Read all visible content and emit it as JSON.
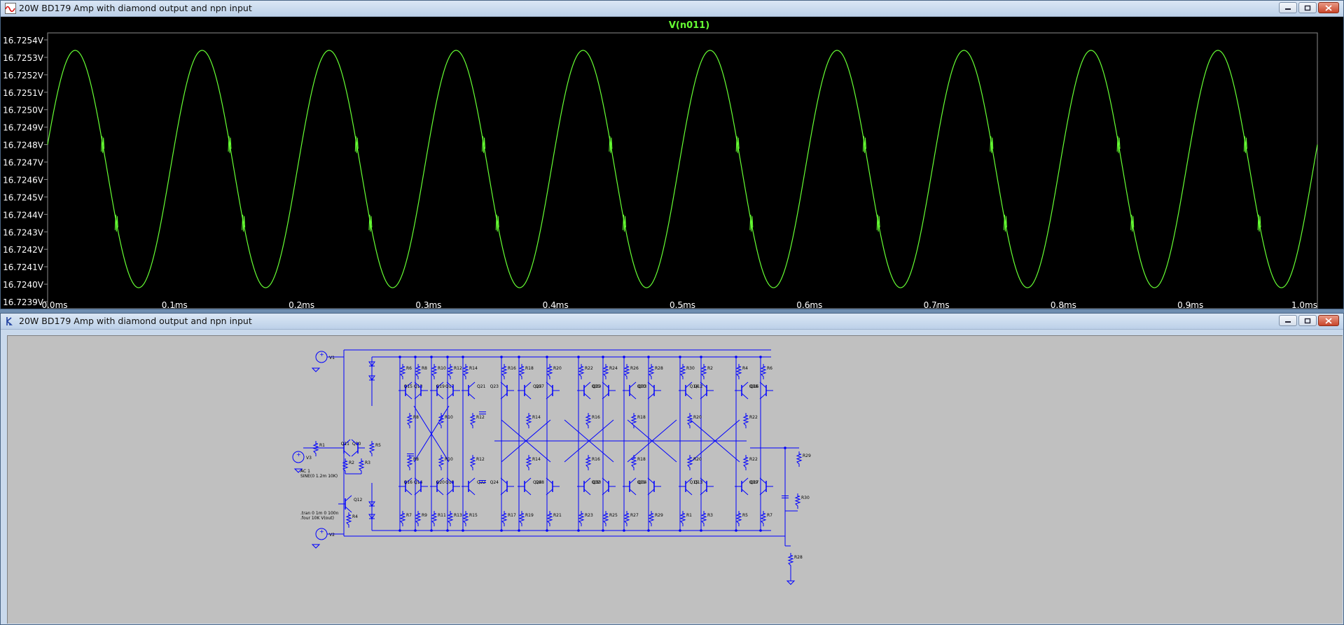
{
  "plot_window": {
    "title": "20W BD179 Amp with diamond output and npn input",
    "icon": "waveform-icon",
    "trace_label": "V(n011)",
    "trace_color": "#66ff33",
    "label_color": "#ffffff",
    "grid_color": "#8c8c8c"
  },
  "schematic_window": {
    "title": "20W BD179 Amp with diamond output and npn input",
    "icon": "schematic-icon",
    "wire_color": "#0000ff",
    "background": "#c0c0c0"
  },
  "chart_data": {
    "type": "line",
    "title": "V(n011)",
    "xlabel": "",
    "ylabel": "",
    "x_ticks": [
      "0.0ms",
      "0.1ms",
      "0.2ms",
      "0.3ms",
      "0.4ms",
      "0.5ms",
      "0.6ms",
      "0.7ms",
      "0.8ms",
      "0.9ms",
      "1.0ms"
    ],
    "y_ticks": [
      "16.7254V",
      "16.7253V",
      "16.7252V",
      "16.7251V",
      "16.7250V",
      "16.7249V",
      "16.7248V",
      "16.7247V",
      "16.7246V",
      "16.7245V",
      "16.7244V",
      "16.7243V",
      "16.7242V",
      "16.7241V",
      "16.7240V",
      "16.7239V"
    ],
    "xlim": [
      0.0,
      1.0
    ],
    "ylim": [
      16.7239,
      16.7254
    ],
    "x_unit": "ms",
    "y_unit": "V",
    "grid": false,
    "series": [
      {
        "name": "V(n011)",
        "waveform": "sine",
        "frequency_khz": 10,
        "offset_v": 16.72466,
        "amplitude_v": 0.00068,
        "start_value_v": 16.7248,
        "glitch_values_v": [
          16.7248,
          16.72435
        ]
      }
    ]
  },
  "schematic_labels": {
    "transistors": [
      "Q10",
      "Q11",
      "Q12",
      "Q13",
      "Q14",
      "Q15",
      "Q16",
      "Q17",
      "Q18",
      "Q19",
      "Q20",
      "Q21",
      "Q22",
      "Q23",
      "Q24",
      "Q25",
      "Q26",
      "Q27",
      "Q28",
      "Q29",
      "Q30",
      "Q31",
      "Q32",
      "Q33",
      "Q34"
    ],
    "resistors": [
      "R1",
      "R2",
      "R3",
      "R4",
      "R5",
      "R6",
      "R7",
      "R8",
      "R9",
      "R10",
      "R11",
      "R12",
      "R13",
      "R14",
      "R15",
      "R16",
      "R17",
      "R18",
      "R19",
      "R20",
      "R21",
      "R22",
      "R23",
      "R24",
      "R25",
      "R26",
      "R27",
      "R28",
      "R29",
      "R30"
    ],
    "sources": [
      "V1",
      "V2",
      "V3"
    ],
    "directives": [
      ".tran 0 1m 0 100n",
      ".four 10K V(out)",
      "AC 1",
      "SINE(0 1.2m 10K)"
    ]
  }
}
